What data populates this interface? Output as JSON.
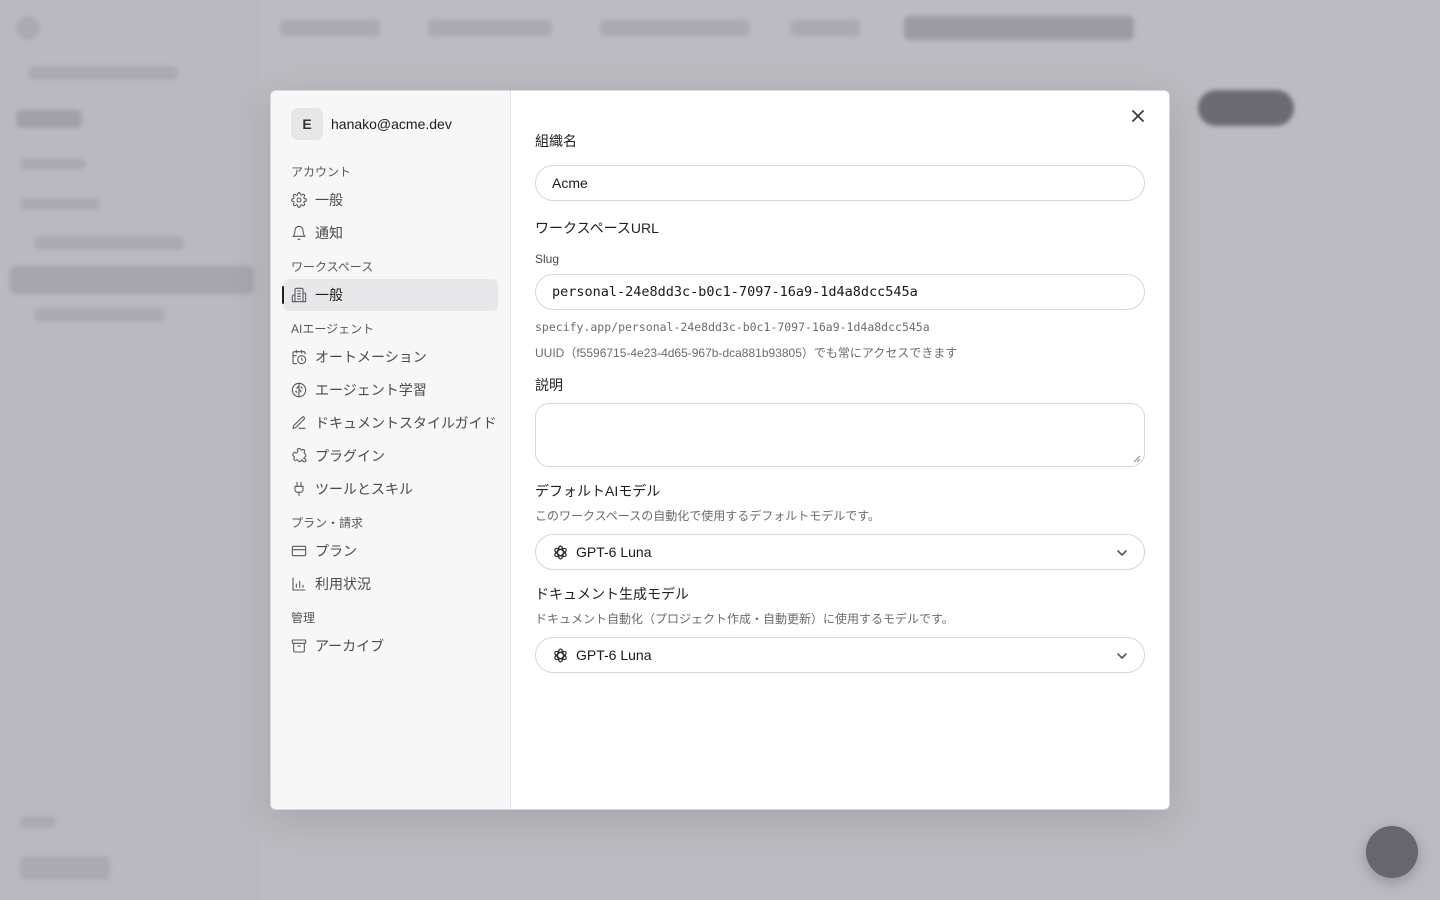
{
  "modal": {
    "user": {
      "initial": "E",
      "email": "hanako@acme.dev"
    },
    "nav": {
      "sections": [
        {
          "label": "アカウント",
          "items": [
            "一般",
            "通知"
          ]
        },
        {
          "label": "ワークスペース",
          "items": [
            "一般"
          ]
        },
        {
          "label": "AIエージェント",
          "items": [
            "オートメーション",
            "エージェント学習",
            "ドキュメントスタイルガイド",
            "プラグイン",
            "ツールとスキル"
          ]
        },
        {
          "label": "プラン・請求",
          "items": [
            "プラン",
            "利用状況"
          ]
        },
        {
          "label": "管理",
          "items": [
            "アーカイブ"
          ]
        }
      ],
      "active": "ワークスペース / 一般"
    },
    "form": {
      "org_name_label": "組織名",
      "org_name_value": "Acme",
      "workspace_url_label": "ワークスペースURL",
      "slug_label": "Slug",
      "slug_value": "personal-24e8dd3c-b0c1-7097-16a9-1d4a8dcc545a",
      "url_preview": "specify.app/personal-24e8dd3c-b0c1-7097-16a9-1d4a8dcc545a",
      "uuid_note": "UUID（f5596715-4e23-4d65-967b-dca881b93805）でも常にアクセスできます",
      "description_label": "説明",
      "description_value": "",
      "default_model_label": "デフォルトAIモデル",
      "default_model_help": "このワークスペースの自動化で使用するデフォルトモデルです。",
      "default_model_value": "GPT-6 Luna",
      "doc_model_label": "ドキュメント生成モデル",
      "doc_model_help": "ドキュメント自動化（プロジェクト作成・自動更新）に使用するモデルです。",
      "doc_model_value": "GPT-6 Luna"
    }
  },
  "icons": {
    "account_general": "gear-icon",
    "account_notifications": "bell-icon",
    "workspace_general": "building-icon",
    "automation": "calendar-clock-icon",
    "agent_learning": "brain-icon",
    "style_guide": "pen-icon",
    "plugins": "puzzle-icon",
    "tools": "plug-icon",
    "plan": "credit-card-icon",
    "usage": "bar-chart-icon",
    "archive": "archive-icon",
    "close": "close-icon",
    "model": "openai-logo-icon",
    "dropdown": "chevron-down-icon"
  },
  "colors": {
    "overlay": "#94939d",
    "nav_bg": "#f7f7f7",
    "active_item_bg": "#e8e8ea",
    "border": "#d6d6da"
  }
}
